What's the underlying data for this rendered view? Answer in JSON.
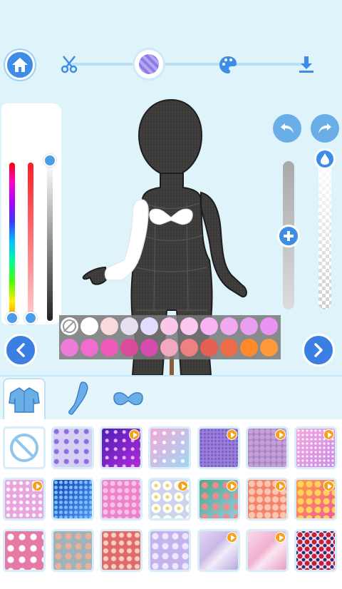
{
  "toolbar": {
    "steps": [
      {
        "name": "cut",
        "icon": "scissors-icon"
      },
      {
        "name": "fabric",
        "icon": "fabric-icon",
        "active": true
      },
      {
        "name": "paint",
        "icon": "palette-icon"
      },
      {
        "name": "save",
        "icon": "download-icon"
      }
    ]
  },
  "color_sliders": {
    "hue_level": 1.0,
    "saturation_level": 1.0,
    "brightness_level": 0.0
  },
  "opacity_slider": {
    "level": 0.5
  },
  "palette": {
    "row1": [
      "none",
      "#ffffff",
      "#f9d9d9",
      "#e6dff0",
      "#e3dcff",
      "#f9c7ea",
      "#f9c7f0",
      "#f7b3f2",
      "#f2a9f2",
      "#ea9ef0",
      "#e994f2"
    ],
    "row2": [
      "#f07ad7",
      "#f06cce",
      "#ef5ab9",
      "#db4a9b",
      "#d64bad",
      "#f2a8bf",
      "#ee8080",
      "#e56050",
      "#ee6d48",
      "#ff8a2a",
      "#ff9a38"
    ]
  },
  "tabs": [
    {
      "name": "top",
      "icon": "shirt-icon",
      "active": true
    },
    {
      "name": "sleeve",
      "icon": "sleeve-icon"
    },
    {
      "name": "bow",
      "icon": "bow-icon"
    }
  ],
  "patterns": [
    {
      "name": "none",
      "premium": false
    },
    {
      "name": "purple-stars",
      "premium": false
    },
    {
      "name": "galaxy-purple",
      "premium": true
    },
    {
      "name": "pink-sparkle",
      "premium": false
    },
    {
      "name": "violet-glitter",
      "premium": true
    },
    {
      "name": "lilac-sequin",
      "premium": true
    },
    {
      "name": "pink-glitter",
      "premium": true
    },
    {
      "name": "pink-lace",
      "premium": true
    },
    {
      "name": "blue-sequin",
      "premium": false
    },
    {
      "name": "pink-pattern",
      "premium": false
    },
    {
      "name": "daisy",
      "premium": true
    },
    {
      "name": "tropical",
      "premium": true
    },
    {
      "name": "coral-floral",
      "premium": true
    },
    {
      "name": "orange-floral",
      "premium": true
    },
    {
      "name": "cherry-blossom",
      "premium": false
    },
    {
      "name": "vintage-floral",
      "premium": false
    },
    {
      "name": "red-floral",
      "premium": false
    },
    {
      "name": "lavender-floral",
      "premium": false
    },
    {
      "name": "pearl-satin",
      "premium": true
    },
    {
      "name": "pink-satin",
      "premium": true
    },
    {
      "name": "rose-print",
      "premium": false
    }
  ]
}
